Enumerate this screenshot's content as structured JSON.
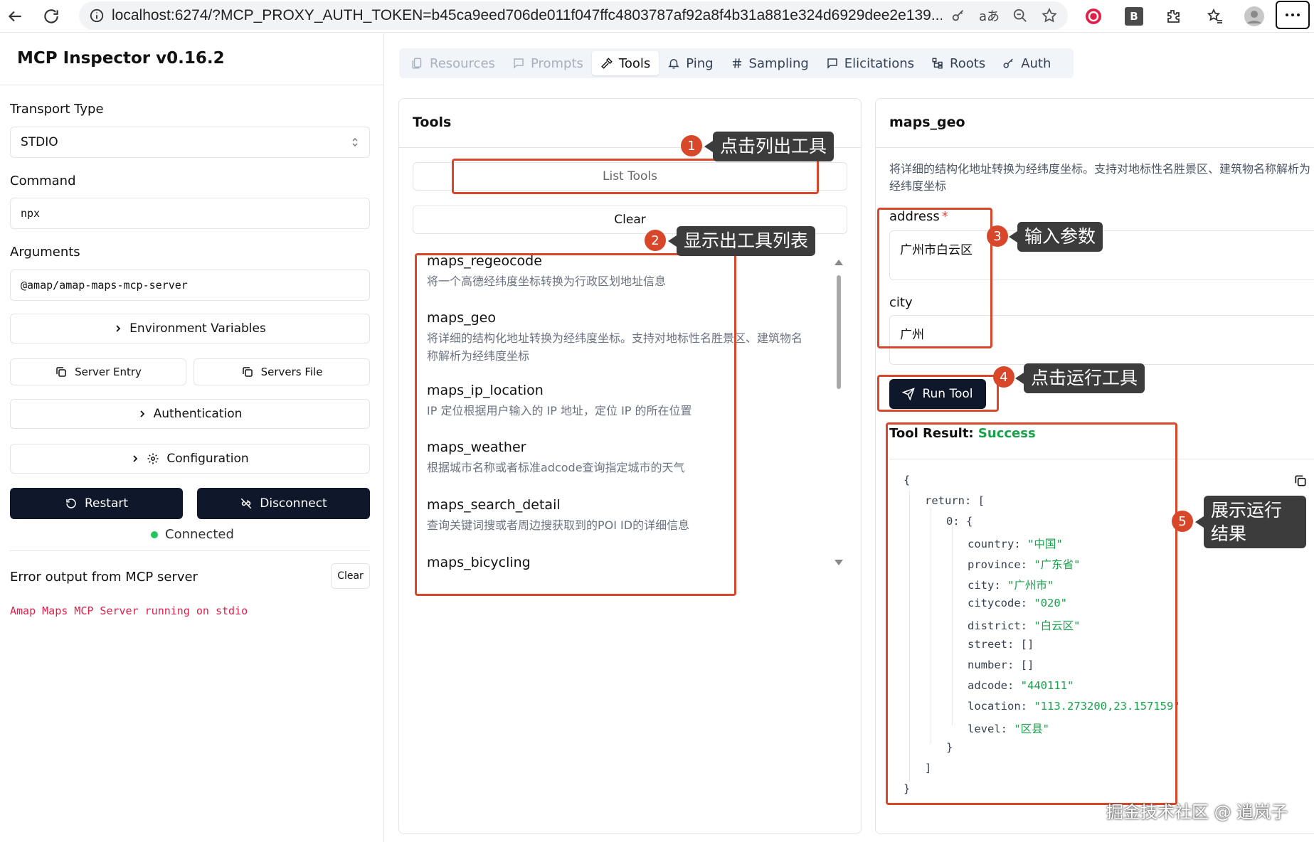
{
  "browser": {
    "url": "localhost:6274/?MCP_PROXY_AUTH_TOKEN=b45ca9eed706de011f047ffc4803787af92a8f4b31a881e324d6929dee2e139...",
    "ext_b_label": "B"
  },
  "sidebar": {
    "title": "MCP Inspector v0.16.2",
    "transport_label": "Transport Type",
    "transport_value": "STDIO",
    "command_label": "Command",
    "command_value": "npx",
    "arguments_label": "Arguments",
    "arguments_value": "@amap/amap-maps-mcp-server",
    "env_vars": "Environment Variables",
    "server_entry": "Server Entry",
    "servers_file": "Servers File",
    "authentication": "Authentication",
    "configuration": "Configuration",
    "restart": "Restart",
    "disconnect": "Disconnect",
    "status": "Connected",
    "status_color": "#22c55e",
    "error_label": "Error output from MCP server",
    "error_clear": "Clear",
    "error_text": "Amap Maps MCP Server running on stdio",
    "error_color": "#e11d48"
  },
  "tabs": [
    {
      "label": "Resources",
      "icon": "resources-icon",
      "state": "disabled"
    },
    {
      "label": "Prompts",
      "icon": "prompts-icon",
      "state": "disabled"
    },
    {
      "label": "Tools",
      "icon": "hammer-icon",
      "state": "active"
    },
    {
      "label": "Ping",
      "icon": "bell-icon",
      "state": "normal"
    },
    {
      "label": "Sampling",
      "icon": "hash-icon",
      "state": "normal"
    },
    {
      "label": "Elicitations",
      "icon": "message-icon",
      "state": "normal"
    },
    {
      "label": "Roots",
      "icon": "tree-icon",
      "state": "normal"
    },
    {
      "label": "Auth",
      "icon": "key-icon",
      "state": "normal"
    }
  ],
  "tools_panel": {
    "title": "Tools",
    "list_tools": "List Tools",
    "clear": "Clear",
    "items": [
      {
        "name": "maps_regeocode",
        "desc": "将一个高德经纬度坐标转换为行政区划地址信息"
      },
      {
        "name": "maps_geo",
        "desc": "将详细的结构化地址转换为经纬度坐标。支持对地标性名胜景区、建筑物名称解析为经纬度坐标"
      },
      {
        "name": "maps_ip_location",
        "desc": "IP 定位根据用户输入的 IP 地址，定位 IP 的所在位置"
      },
      {
        "name": "maps_weather",
        "desc": "根据城市名称或者标准adcode查询指定城市的天气"
      },
      {
        "name": "maps_search_detail",
        "desc": "查询关键词搜或者周边搜获取到的POI ID的详细信息"
      },
      {
        "name": "maps_bicycling",
        "desc": ""
      }
    ]
  },
  "detail_panel": {
    "title": "maps_geo",
    "desc": "将详细的结构化地址转换为经纬度坐标。支持对地标性名胜景区、建筑物名称解析为经纬度坐标",
    "address_label": "address",
    "required_mark": "*",
    "address_value": "广州市白云区",
    "city_label": "city",
    "city_value": "广州",
    "run_tool": "Run Tool",
    "result_label": "Tool Result:",
    "result_status": "Success",
    "success_color": "#16a34a",
    "code": {
      "open_brace": "{",
      "return_key": "return: [",
      "index_key": "0: {",
      "fields": [
        {
          "key": "country: ",
          "value": "\"中国\""
        },
        {
          "key": "province: ",
          "value": "\"广东省\""
        },
        {
          "key": "city: ",
          "value": "\"广州市\""
        },
        {
          "key": "citycode: ",
          "value": "\"020\""
        },
        {
          "key": "district: ",
          "value": "\"白云区\""
        },
        {
          "key": "street: ",
          "value": "[]",
          "plain": true
        },
        {
          "key": "number: ",
          "value": "[]",
          "plain": true
        },
        {
          "key": "adcode: ",
          "value": "\"440111\""
        },
        {
          "key": "location: ",
          "value": "\"113.273200,23.157159\""
        },
        {
          "key": "level: ",
          "value": "\"区县\""
        }
      ],
      "close_inner": "}",
      "close_array": "]",
      "close_outer": "}"
    }
  },
  "annotations": [
    {
      "num": "1",
      "text": "点击列出工具"
    },
    {
      "num": "2",
      "text": "显示出工具列表"
    },
    {
      "num": "3",
      "text": "输入参数"
    },
    {
      "num": "4",
      "text": "点击运行工具"
    },
    {
      "num": "5",
      "text": "展示运行结果"
    }
  ],
  "annotation_color": "#d9472b",
  "watermark": "掘金技术社区 @ 逍岚子"
}
